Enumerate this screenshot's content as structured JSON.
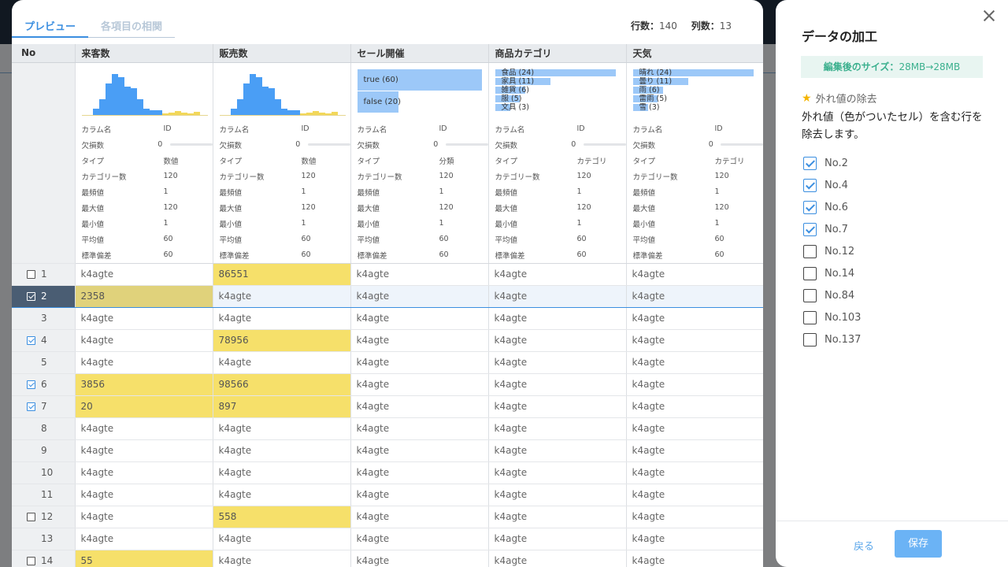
{
  "tabs": [
    {
      "label": "プレビュー",
      "active": true
    },
    {
      "label": "各項目の相関",
      "active": false
    }
  ],
  "counts": {
    "rows_label": "行数：",
    "rows": "140",
    "cols_label": "列数：",
    "cols": "13"
  },
  "columns": [
    "No",
    "来客数",
    "販売数",
    "セール開催",
    "商品カテゴリ",
    "天気"
  ],
  "stat_labels": [
    "カラム名",
    "欠損数",
    "タイプ",
    "カテゴリー数",
    "最頻値",
    "最大値",
    "最小値",
    "平均値",
    "標準偏差"
  ],
  "stats": [
    [
      "ID",
      "0",
      "数値",
      "120",
      "1",
      "120",
      "1",
      "60",
      "60"
    ],
    [
      "ID",
      "0",
      "数値",
      "120",
      "1",
      "120",
      "1",
      "60",
      "60"
    ],
    [
      "ID",
      "0",
      "分類",
      "120",
      "1",
      "120",
      "1",
      "60",
      "60"
    ],
    [
      "ID",
      "0",
      "カテゴリ",
      "120",
      "1",
      "120",
      "1",
      "60",
      "60"
    ],
    [
      "ID",
      "0",
      "カテゴリ",
      "120",
      "1",
      "120",
      "1",
      "60",
      "60"
    ]
  ],
  "column_charts": {
    "histogram_blue": [
      8,
      20,
      40,
      52,
      48,
      36,
      34,
      20,
      8,
      6,
      6
    ],
    "histogram_yellow": [
      2,
      3,
      5,
      3,
      2,
      4
    ],
    "sale_bars": [
      {
        "label": "true (60)",
        "value": 60
      },
      {
        "label": "false (20)",
        "value": 20
      }
    ],
    "category_bars": [
      {
        "label": "食品 (24)",
        "value": 24
      },
      {
        "label": "家具 (11)",
        "value": 11
      },
      {
        "label": "雑貨 (6)",
        "value": 6
      },
      {
        "label": "服 (5)",
        "value": 5
      },
      {
        "label": "文具 (3)",
        "value": 3
      }
    ],
    "weather_bars": [
      {
        "label": "晴れ (24)",
        "value": 24
      },
      {
        "label": "曇り (11)",
        "value": 11
      },
      {
        "label": "雨 (6)",
        "value": 6
      },
      {
        "label": "雷雨 (5)",
        "value": 5
      },
      {
        "label": "雪 (3)",
        "value": 3
      }
    ]
  },
  "rows": [
    {
      "no": "1",
      "checkbox": true,
      "checked": false,
      "selected": false,
      "cells": [
        "k4agte",
        "86551",
        "k4agte",
        "k4agte",
        "k4agte"
      ],
      "hl": [
        false,
        true,
        false,
        false,
        false
      ]
    },
    {
      "no": "2",
      "checkbox": true,
      "checked": true,
      "selected": true,
      "cells": [
        "2358",
        "k4agte",
        "k4agte",
        "k4agte",
        "k4agte"
      ],
      "hl": [
        true,
        false,
        false,
        false,
        false
      ]
    },
    {
      "no": "3",
      "checkbox": false,
      "checked": false,
      "selected": false,
      "cells": [
        "k4agte",
        "k4agte",
        "k4agte",
        "k4agte",
        "k4agte"
      ],
      "hl": [
        false,
        false,
        false,
        false,
        false
      ]
    },
    {
      "no": "4",
      "checkbox": true,
      "checked": true,
      "selected": false,
      "cells": [
        "k4agte",
        "78956",
        "k4agte",
        "k4agte",
        "k4agte"
      ],
      "hl": [
        false,
        true,
        false,
        false,
        false
      ]
    },
    {
      "no": "5",
      "checkbox": false,
      "checked": false,
      "selected": false,
      "cells": [
        "k4agte",
        "k4agte",
        "k4agte",
        "k4agte",
        "k4agte"
      ],
      "hl": [
        false,
        false,
        false,
        false,
        false
      ]
    },
    {
      "no": "6",
      "checkbox": true,
      "checked": true,
      "selected": false,
      "cells": [
        "3856",
        "98566",
        "k4agte",
        "k4agte",
        "k4agte"
      ],
      "hl": [
        true,
        true,
        false,
        false,
        false
      ]
    },
    {
      "no": "7",
      "checkbox": true,
      "checked": true,
      "selected": false,
      "cells": [
        "20",
        "897",
        "k4agte",
        "k4agte",
        "k4agte"
      ],
      "hl": [
        true,
        true,
        false,
        false,
        false
      ]
    },
    {
      "no": "8",
      "checkbox": false,
      "checked": false,
      "selected": false,
      "cells": [
        "k4agte",
        "k4agte",
        "k4agte",
        "k4agte",
        "k4agte"
      ],
      "hl": [
        false,
        false,
        false,
        false,
        false
      ]
    },
    {
      "no": "9",
      "checkbox": false,
      "checked": false,
      "selected": false,
      "cells": [
        "k4agte",
        "k4agte",
        "k4agte",
        "k4agte",
        "k4agte"
      ],
      "hl": [
        false,
        false,
        false,
        false,
        false
      ]
    },
    {
      "no": "10",
      "checkbox": false,
      "checked": false,
      "selected": false,
      "cells": [
        "k4agte",
        "k4agte",
        "k4agte",
        "k4agte",
        "k4agte"
      ],
      "hl": [
        false,
        false,
        false,
        false,
        false
      ]
    },
    {
      "no": "11",
      "checkbox": false,
      "checked": false,
      "selected": false,
      "cells": [
        "k4agte",
        "k4agte",
        "k4agte",
        "k4agte",
        "k4agte"
      ],
      "hl": [
        false,
        false,
        false,
        false,
        false
      ]
    },
    {
      "no": "12",
      "checkbox": true,
      "checked": false,
      "selected": false,
      "cells": [
        "k4agte",
        "558",
        "k4agte",
        "k4agte",
        "k4agte"
      ],
      "hl": [
        false,
        true,
        false,
        false,
        false
      ]
    },
    {
      "no": "13",
      "checkbox": false,
      "checked": false,
      "selected": false,
      "cells": [
        "k4agte",
        "k4agte",
        "k4agte",
        "k4agte",
        "k4agte"
      ],
      "hl": [
        false,
        false,
        false,
        false,
        false
      ]
    },
    {
      "no": "14",
      "checkbox": true,
      "checked": false,
      "selected": false,
      "cells": [
        "55",
        "k4agte",
        "k4agte",
        "k4agte",
        "k4agte"
      ],
      "hl": [
        true,
        false,
        false,
        false,
        false
      ]
    }
  ],
  "side": {
    "title": "データの加工",
    "size_label": "編集後のサイズ：",
    "size_value": "28MB→28MB",
    "section_title": "外れ値の除去",
    "description": "外れ値（色がついたセル）を含む行を除去します。",
    "options": [
      {
        "label": "No.2",
        "checked": true
      },
      {
        "label": "No.4",
        "checked": true
      },
      {
        "label": "No.6",
        "checked": true
      },
      {
        "label": "No.7",
        "checked": true
      },
      {
        "label": "No.12",
        "checked": false
      },
      {
        "label": "No.14",
        "checked": false
      },
      {
        "label": "No.84",
        "checked": false
      },
      {
        "label": "No.103",
        "checked": false
      },
      {
        "label": "No.137",
        "checked": false
      }
    ],
    "back_label": "戻る",
    "save_label": "保存"
  },
  "colors": {
    "accent": "#3a8ee0",
    "outlier": "#f6e06a",
    "bar": "#9cc8f8",
    "histogram": "#4a9ef5"
  }
}
